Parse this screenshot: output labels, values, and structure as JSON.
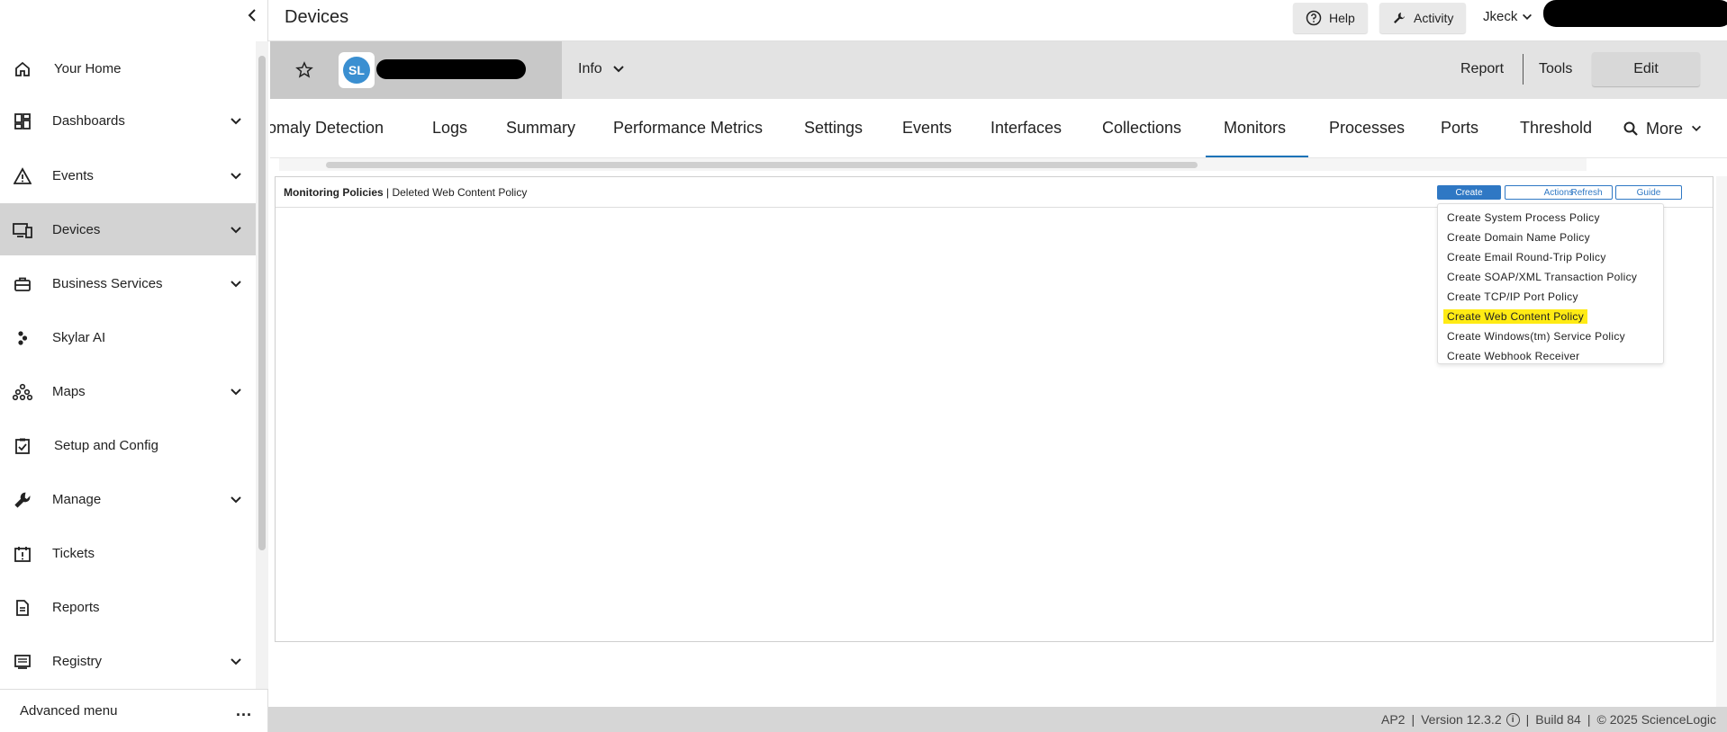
{
  "header": {
    "title": "Devices",
    "help_label": "Help",
    "activity_label": "Activity",
    "user_label": "Jkeck"
  },
  "sidebar": {
    "items": [
      {
        "label": "Your Home",
        "icon": "home-icon",
        "expandable": false,
        "active": false
      },
      {
        "label": "Dashboards",
        "icon": "dashboard-icon",
        "expandable": true,
        "active": false
      },
      {
        "label": "Events",
        "icon": "warning-icon",
        "expandable": true,
        "active": false
      },
      {
        "label": "Devices",
        "icon": "devices-icon",
        "expandable": true,
        "active": true
      },
      {
        "label": "Business Services",
        "icon": "briefcase-icon",
        "expandable": true,
        "active": false
      },
      {
        "label": "Skylar AI",
        "icon": "skylar-icon",
        "expandable": false,
        "active": false
      },
      {
        "label": "Maps",
        "icon": "maps-icon",
        "expandable": true,
        "active": false
      },
      {
        "label": "Setup and Config",
        "icon": "clipboard-check-icon",
        "expandable": false,
        "active": false
      },
      {
        "label": "Manage",
        "icon": "wrench-icon",
        "expandable": true,
        "active": false
      },
      {
        "label": "Tickets",
        "icon": "calendar-alert-icon",
        "expandable": false,
        "active": false
      },
      {
        "label": "Reports",
        "icon": "document-icon",
        "expandable": false,
        "active": false
      },
      {
        "label": "Registry",
        "icon": "registry-icon",
        "expandable": true,
        "active": false
      }
    ],
    "advanced_menu_label": "Advanced menu",
    "advanced_menu_dots": "..."
  },
  "device_bar": {
    "logo_text": "SL",
    "info_label": "Info",
    "report_label": "Report",
    "tools_label": "Tools",
    "edit_label": "Edit"
  },
  "tabs": {
    "items": [
      "omaly Detection",
      "Logs",
      "Summary",
      "Performance Metrics",
      "Settings",
      "Events",
      "Interfaces",
      "Collections",
      "Monitors",
      "Processes",
      "Ports",
      "Threshold"
    ],
    "active": "Monitors",
    "more_label": "More"
  },
  "panel": {
    "title_bold": "Monitoring Policies",
    "title_sep": " | ",
    "title_rest": "Deleted Web Content Policy",
    "buttons": {
      "create": "Create",
      "actions": "Actions",
      "refresh": "Refresh",
      "guide": "Guide"
    },
    "create_menu": [
      {
        "label": "Create System Process Policy",
        "highlighted": false
      },
      {
        "label": "Create Domain Name Policy",
        "highlighted": false
      },
      {
        "label": "Create Email Round-Trip Policy",
        "highlighted": false
      },
      {
        "label": "Create SOAP/XML Transaction Policy",
        "highlighted": false
      },
      {
        "label": "Create TCP/IP Port Policy",
        "highlighted": false
      },
      {
        "label": "Create Web Content Policy",
        "highlighted": true
      },
      {
        "label": "Create Windows(tm) Service Policy",
        "highlighted": false
      },
      {
        "label": "Create Webhook Receiver",
        "highlighted": false
      }
    ]
  },
  "footer": {
    "instance": "AP2",
    "version": "Version 12.3.2",
    "build": "Build 84",
    "copyright": "© 2025 ScienceLogic",
    "separator": "|"
  },
  "colors": {
    "accent": "#2f78c4",
    "active_nav": "#d3d3d3",
    "highlight": "#ffeb14",
    "tab_underline": "#1a73b8"
  }
}
